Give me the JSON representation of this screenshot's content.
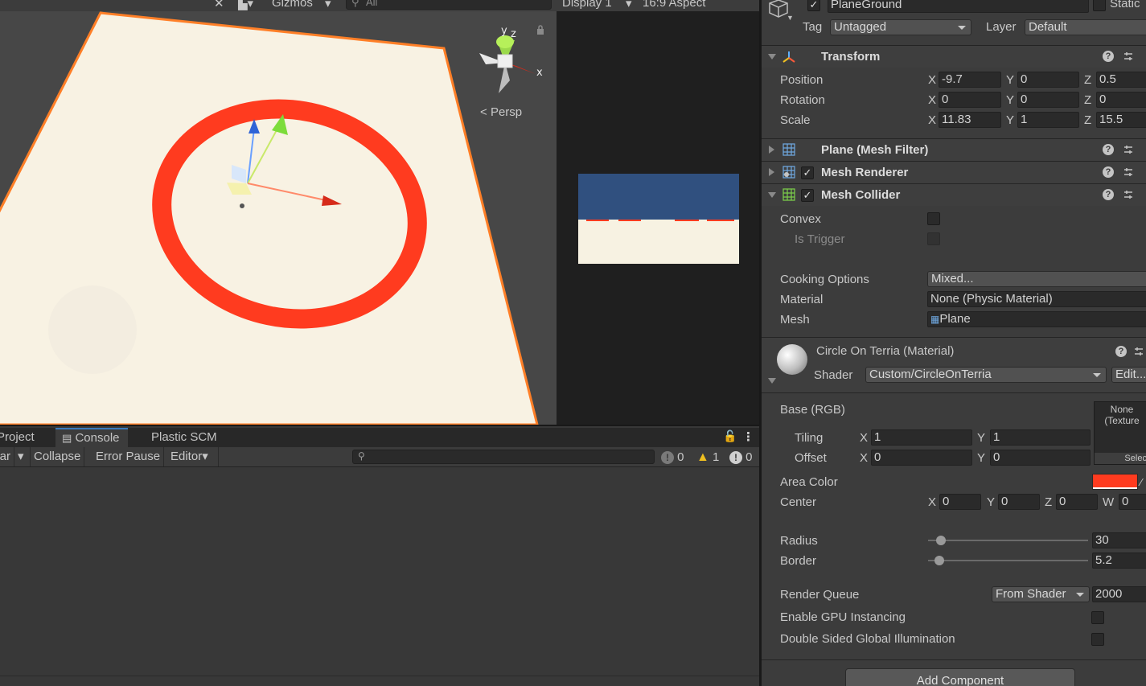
{
  "scene": {
    "toolbar": {
      "gizmos_label": "Gizmos",
      "search_placeholder": "All"
    },
    "persp_label": "Persp",
    "axis_x": "x",
    "axis_y": "y",
    "axis_z": "z"
  },
  "game": {
    "toolbar": {
      "display_label": "Display 1",
      "aspect_label": "16:9 Aspect"
    },
    "preview": {
      "sky_color": "#30507f",
      "ground_color": "#f7f2e2",
      "ring_color": "#ff3b1f"
    }
  },
  "console": {
    "tabs": [
      {
        "label": "Project"
      },
      {
        "label": "Console"
      },
      {
        "label": "Plastic SCM"
      }
    ],
    "toolbar": {
      "clear_label": "Clear",
      "collapse_label": "Collapse",
      "error_pause_label": "Error Pause",
      "editor_label": "Editor",
      "search_value": ""
    },
    "counts": {
      "messages": "0",
      "warnings": "1",
      "errors": "0"
    }
  },
  "inspector": {
    "object_name": "PlaneGround",
    "static_label": "Static",
    "tag_label": "Tag",
    "tag_value": "Untagged",
    "layer_label": "Layer",
    "layer_value": "Default",
    "transform": {
      "title": "Transform",
      "position_label": "Position",
      "rotation_label": "Rotation",
      "scale_label": "Scale",
      "position": {
        "x": "-9.7",
        "y": "0",
        "z": "0.5"
      },
      "rotation": {
        "x": "0",
        "y": "0",
        "z": "0"
      },
      "scale": {
        "x": "11.83",
        "y": "1",
        "z": "15.5"
      }
    },
    "mesh_filter": {
      "title": "Plane (Mesh Filter)"
    },
    "mesh_renderer": {
      "title": "Mesh Renderer",
      "enabled": true
    },
    "mesh_collider": {
      "title": "Mesh Collider",
      "enabled": true,
      "convex_label": "Convex",
      "is_trigger_label": "Is Trigger",
      "cooking_options_label": "Cooking Options",
      "cooking_options_value": "Mixed...",
      "material_label": "Material",
      "material_value": "None (Physic Material)",
      "mesh_label": "Mesh",
      "mesh_value": "Plane"
    },
    "material": {
      "title": "Circle On Terria (Material)",
      "shader_label": "Shader",
      "shader_value": "Custom/CircleOnTerria",
      "edit_label": "Edit...",
      "base_label": "Base (RGB)",
      "texture_none": "None",
      "texture_type": "(Texture",
      "texture_select": "Select",
      "tiling_label": "Tiling",
      "offset_label": "Offset",
      "tiling": {
        "x": "1",
        "y": "1"
      },
      "offset": {
        "x": "0",
        "y": "0"
      },
      "area_color_label": "Area Color",
      "area_color": "#ff3b1f",
      "center_label": "Center",
      "center": {
        "x": "0",
        "y": "0",
        "z": "0",
        "w": "0"
      },
      "radius_label": "Radius",
      "radius_value": "30",
      "border_label": "Border",
      "border_value": "5.2",
      "render_queue_label": "Render Queue",
      "render_queue_mode": "From Shader",
      "render_queue_value": "2000",
      "gpu_instancing_label": "Enable GPU Instancing",
      "double_sided_gi_label": "Double Sided Global Illumination"
    },
    "add_component_label": "Add Component"
  },
  "colors": {
    "plane_fill": "#f8f2e3",
    "plane_outline": "#ff7f27",
    "ring": "#ff3b1f",
    "selection_accent": "#3a79bb"
  }
}
